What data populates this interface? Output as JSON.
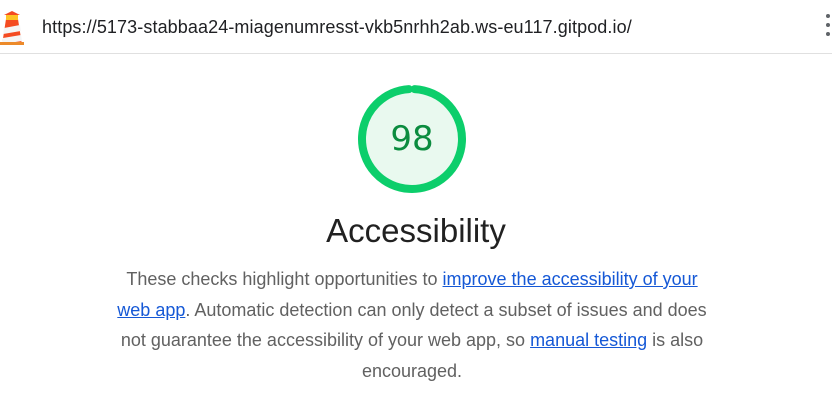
{
  "header": {
    "url": "https://5173-stabbaa24-miagenumresst-vkb5nrhh2ab.ws-eu117.gitpod.io/"
  },
  "gauge": {
    "score": "98",
    "fraction": 0.98,
    "color_ring": "#0cce6b",
    "color_fill": "#e9f9ef",
    "color_text": "#0b8c3f"
  },
  "category": {
    "title": "Accessibility",
    "desc_part1": "These checks highlight opportunities to ",
    "link1": "improve the accessibility of your web app",
    "desc_part2": ". Automatic detection can only detect a subset of issues and does not guarantee the accessibility of your web app, so ",
    "link2": "manual testing",
    "desc_part3": " is also encouraged."
  }
}
